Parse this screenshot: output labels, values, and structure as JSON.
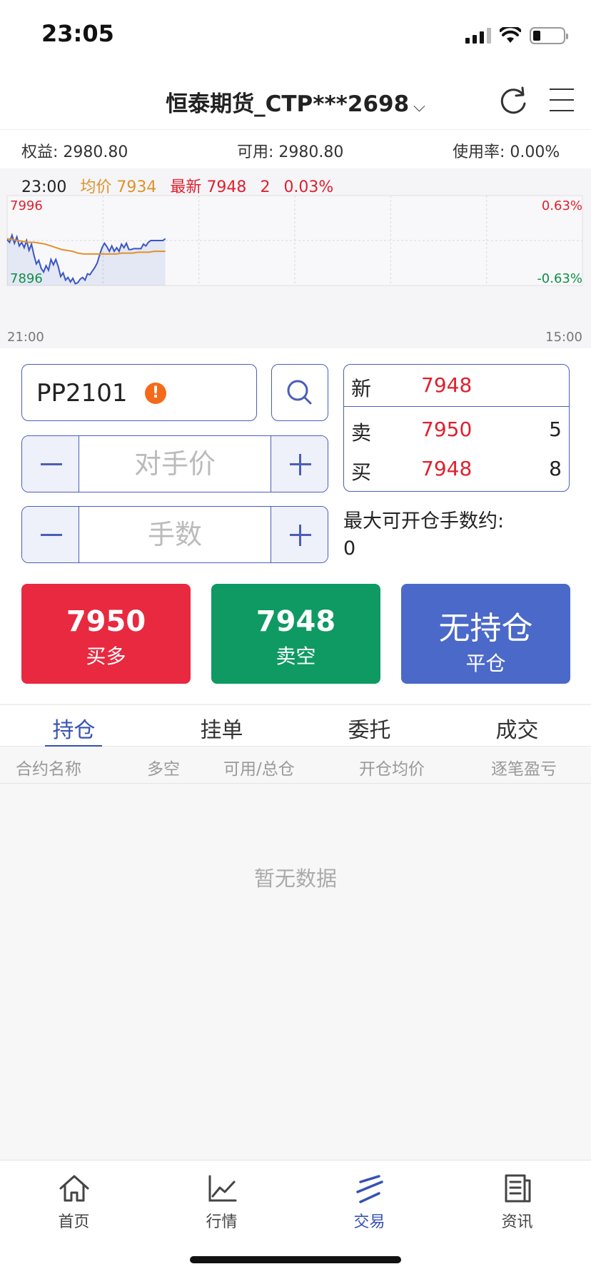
{
  "status_bar": {
    "time": "23:05"
  },
  "header": {
    "title": "恒泰期货_CTP***2698",
    "dropdown_icon": "chevron-down-icon",
    "refresh_icon": "refresh-icon",
    "menu_icon": "menu-icon"
  },
  "account": {
    "equity_label": "权益:",
    "equity_value": "2980.80",
    "available_label": "可用:",
    "available_value": "2980.80",
    "usage_label": "使用率:",
    "usage_value": "0.00%"
  },
  "chart": {
    "time": "23:00",
    "avg_label": "均价",
    "avg_value": "7934",
    "latest_label": "最新",
    "latest_value": "7948",
    "change": "2",
    "change_pct": "0.03%",
    "high_label": "7996",
    "low_label": "7896",
    "high_pct": "0.63%",
    "low_pct": "-0.63%",
    "start_time": "21:00",
    "end_time": "15:00",
    "colors": {
      "price": "#3a56c4",
      "avg": "#e0922a",
      "up": "#e0202e",
      "down": "#0e8f46"
    }
  },
  "chart_data": {
    "type": "line",
    "ylim": [
      7896,
      7996
    ],
    "series": [
      {
        "name": "最新",
        "values": [
          7947,
          7944,
          7952,
          7943,
          7950,
          7940,
          7944,
          7938,
          7946,
          7935,
          7942,
          7930,
          7920,
          7924,
          7915,
          7911,
          7918,
          7913,
          7925,
          7919,
          7925,
          7917,
          7906,
          7910,
          7902,
          7905,
          7900,
          7904,
          7898,
          7899,
          7903,
          7905,
          7902,
          7909,
          7908,
          7912,
          7916,
          7921,
          7930,
          7938,
          7943,
          7939,
          7934,
          7940,
          7934,
          7938,
          7934,
          7942,
          7938,
          7943,
          7936,
          7936,
          7937,
          7937,
          7937,
          7937,
          7942,
          7940,
          7944,
          7946,
          7946,
          7946,
          7946,
          7946,
          7946,
          7948
        ]
      },
      {
        "name": "均价",
        "values": [
          7948,
          7947,
          7946,
          7945,
          7944,
          7944,
          7943,
          7942,
          7940,
          7938,
          7936,
          7935,
          7934,
          7932,
          7931,
          7931,
          7931,
          7931,
          7931,
          7931,
          7931,
          7932,
          7932,
          7932,
          7933,
          7933,
          7933,
          7934,
          7934,
          7934
        ]
      }
    ]
  },
  "order": {
    "symbol": "PP2101",
    "price_placeholder": "对手价",
    "qty_placeholder": "手数",
    "max_open_label": "最大可开仓手数约:",
    "max_open_value": "0"
  },
  "quote": {
    "last_label": "新",
    "last_price": "7948",
    "ask_label": "卖",
    "ask_price": "7950",
    "ask_qty": "5",
    "bid_label": "买",
    "bid_price": "7948",
    "bid_qty": "8"
  },
  "actions": {
    "buy_price": "7950",
    "buy_label": "买多",
    "sell_price": "7948",
    "sell_label": "卖空",
    "close_title": "无持仓",
    "close_label": "平仓"
  },
  "tabs": [
    {
      "label": "持仓",
      "active": true
    },
    {
      "label": "挂单",
      "active": false
    },
    {
      "label": "委托",
      "active": false
    },
    {
      "label": "成交",
      "active": false
    }
  ],
  "table": {
    "columns": [
      "合约名称",
      "多空",
      "可用/总仓",
      "开仓均价",
      "逐笔盈亏"
    ],
    "empty_text": "暂无数据"
  },
  "bottom_nav": [
    {
      "label": "首页",
      "icon": "home-icon",
      "active": false
    },
    {
      "label": "行情",
      "icon": "chart-icon",
      "active": false
    },
    {
      "label": "交易",
      "icon": "trade-icon",
      "active": true
    },
    {
      "label": "资讯",
      "icon": "news-icon",
      "active": false
    }
  ]
}
